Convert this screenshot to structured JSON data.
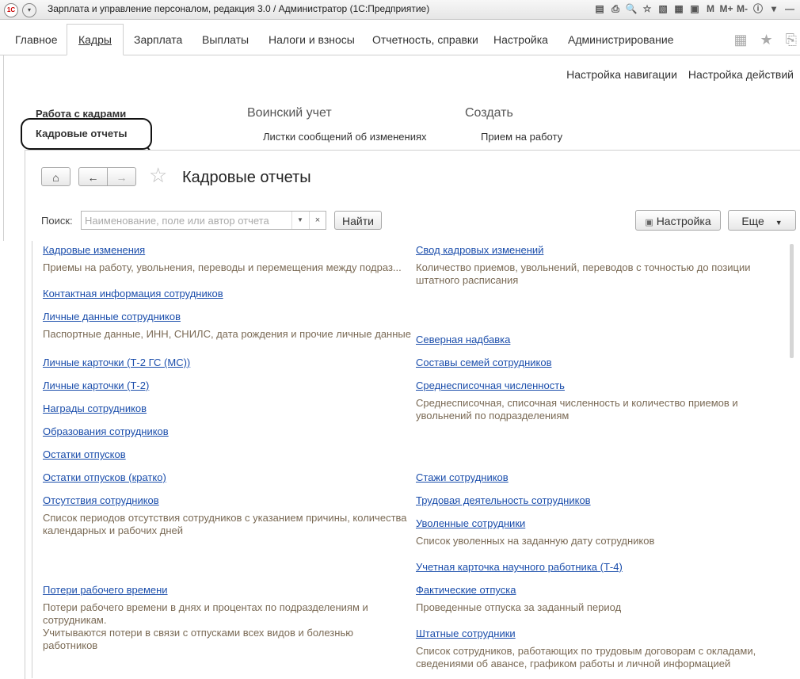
{
  "window": {
    "title": "Зарплата и управление персоналом, редакция 3.0 / Администратор  (1С:Предприятие)",
    "logo_text": "1С",
    "tools": [
      "▤",
      "⎙",
      "🔍",
      "☆",
      "▧",
      "▦",
      "▣",
      "M",
      "M+",
      "M-",
      "ⓘ",
      "▾",
      "—"
    ]
  },
  "menubar": {
    "items": [
      "Главное",
      "Кадры",
      "Зарплата",
      "Выплаты",
      "Налоги и взносы",
      "Отчетность, справки",
      "Настройка",
      "Администрирование"
    ],
    "active": "Кадры"
  },
  "nav_actions": {
    "nav_settings": "Настройка навигации",
    "actions_settings": "Настройка действий"
  },
  "sections": {
    "work_title": "Работа с кадрами",
    "work_item": "Кадровые отчеты",
    "military_title": "Воинский учет",
    "military_item": "Листки сообщений об изменениях",
    "create_title": "Создать",
    "create_item": "Прием на работу"
  },
  "form": {
    "title": "Кадровые отчеты",
    "search_label": "Поиск:",
    "search_placeholder": "Наименование, поле или автор отчета",
    "find_button": "Найти",
    "settings_button": "Настройка",
    "more_button": "Еще"
  },
  "reports_left": [
    {
      "name": "Кадровые изменения",
      "desc": "Приемы на работу, увольнения, переводы и перемещения между подраз..."
    },
    {
      "name": "Контактная информация сотрудников",
      "desc": ""
    },
    {
      "name": "Личные данные сотрудников",
      "desc": "Паспортные данные, ИНН, СНИЛС, дата рождения и прочие личные данные"
    },
    {
      "name": "Личные карточки (Т-2 ГС (МС))",
      "desc": ""
    },
    {
      "name": "Личные карточки (Т-2)",
      "desc": ""
    },
    {
      "name": "Награды сотрудников",
      "desc": ""
    },
    {
      "name": "Образования сотрудников",
      "desc": ""
    },
    {
      "name": "Остатки отпусков",
      "desc": ""
    },
    {
      "name": "Остатки отпусков (кратко)",
      "desc": ""
    },
    {
      "name": "Отсутствия сотрудников",
      "desc": "Список периодов отсутствия сотрудников с указанием причины, количества календарных и рабочих дней"
    },
    {
      "name": "Потери рабочего времени",
      "desc": "Потери рабочего времени в днях и процентах по подразделениям и сотрудникам.\nУчитываются потери в связи с отпусками всех видов и болезнью работников"
    }
  ],
  "reports_right": [
    {
      "name": "Свод кадровых изменений",
      "desc": "Количество приемов, увольнений, переводов с точностью до позиции штатного расписания"
    },
    {
      "name": "Северная надбавка",
      "desc": ""
    },
    {
      "name": "Составы семей сотрудников",
      "desc": ""
    },
    {
      "name": "Среднесписочная численность",
      "desc": "Среднесписочная, списочная численность и количество приемов и увольнений по подразделениям"
    },
    {
      "name": "Стажи сотрудников",
      "desc": ""
    },
    {
      "name": "Трудовая деятельность сотрудников",
      "desc": ""
    },
    {
      "name": "Уволенные сотрудники",
      "desc": "Список уволенных на заданную дату сотрудников"
    },
    {
      "name": "Учетная карточка научного работника (Т-4)",
      "desc": ""
    },
    {
      "name": "Фактические отпуска",
      "desc": "Проведенные отпуска за заданный период"
    },
    {
      "name": "Штатные сотрудники",
      "desc": "Список сотрудников, работающих по трудовым договорам с окладами, сведениями об авансе, графиком работы и личной информацией"
    }
  ]
}
